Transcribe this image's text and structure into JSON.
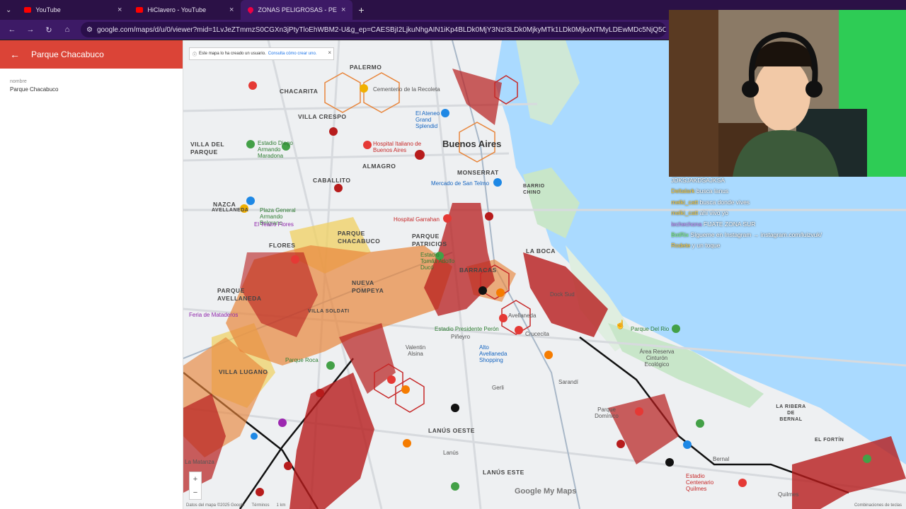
{
  "browser": {
    "tabs": [
      {
        "title": "YouTube",
        "active": false,
        "icon": "youtube-icon"
      },
      {
        "title": "HiClavero - YouTube",
        "active": false,
        "icon": "youtube-icon"
      },
      {
        "title": "ZONAS PELIGROSAS - PEYANE",
        "active": true,
        "icon": "google-maps-icon"
      }
    ],
    "url": "google.com/maps/d/u/0/viewer?mid=1LvJeZTmmzS0CGXn3jPtyTloEhWBM2-U&g_ep=CAESBjI2LjkuNhgAIN1iKp4BLDk0MjY3NzI3LDk0MjkyMTk1LDk0MjkxNTMyLDEwMDc5NjQ5OCwxMDA3OTY"
  },
  "panel": {
    "title": "Parque Chacabuco",
    "field_label": "nombre",
    "field_value": "Parque Chacabuco",
    "header_color": "#db4437"
  },
  "map": {
    "notice_text": "Este mapa lo ha creado un usuario.",
    "notice_link": "Consulta cómo crear uno.",
    "labels": {
      "palermo": "PALERMO",
      "recoleta": "Cementerio de la Recoleta",
      "chacarita": "CHACARITA",
      "villa_crespo": "VILLA CRESPO",
      "ateneo": "El Ateneo Grand Splendid",
      "buenos_aires": "Buenos Aires",
      "villa_del_parque": "VILLA DEL PARQUE",
      "maradona": "Estadio Diego Armando Maradona",
      "hospital_italiano": "Hospital Italiano de Buenos Aires",
      "almagro": "ALMAGRO",
      "monserrat": "MONSERRAT",
      "caballito": "CABALLITO",
      "san_telmo": "Mercado de San Telmo",
      "barrio_chino": "BARRIO CHINO",
      "nazca": "NAZCA",
      "avellaneda_av": "AVELLANEDA",
      "plaza_general": "Plaza General Armando Belgrano",
      "teatro_flores": "El Teatro Flores",
      "parque_chacabuco": "PARQUE CHACABUCO",
      "hospital_garrahan": "Hospital Garrahan",
      "flores": "FLORES",
      "parque_patricios": "PARQUE PATRICIOS",
      "estadio_tomas": "Estadio Tomás Adolfo Ducó",
      "barracas": "BARRACAS",
      "la_boca": "LA BOCA",
      "nueva_pompeya": "NUEVA POMPEYA",
      "parque_avellaneda": "PARQUE AVELLANEDA",
      "dock_sud": "Dock Sud",
      "feria_mataderos": "Feria de Mataderos",
      "villa_soldati": "VILLA SOLDATI",
      "avellaneda": "Avellaneda",
      "estadio_peron": "Estadio Presidente Perón",
      "pineyro": "Piñeyro",
      "crucecita": "Crucecita",
      "parque_del_rio": "Parque Del Rio",
      "area_reserva": "Área Reserva Cinturón Ecológico",
      "valentin_alsina": "Valentin Alsina",
      "alto_avellaneda": "Alto Avellaneda Shopping",
      "villa_lugano": "VILLA LUGANO",
      "parque_roca": "Parque Roca",
      "gerli": "Gerli",
      "sarandi": "Sarandí",
      "lanus_oeste": "LANÚS OESTE",
      "lanus": "Lanús",
      "lanus_este": "LANÚS ESTE",
      "dominico": "Parque Domínico",
      "la_ribera": "LA RIBERA DE BERNAL",
      "bernal": "Bernal",
      "el_fortin": "EL FORTÍN",
      "quilmes": "Quilmes",
      "estadio_quilmes": "Estadio Centenario Quilmes",
      "la_matanza": "La Matanza"
    },
    "zoom_in": "+",
    "zoom_out": "−",
    "footer_data": "Datos del mapa ©2025 Google",
    "footer_terms": "Términos",
    "footer_scale": "1 km",
    "footer_right": "Combinaciones de teclas",
    "watermark": "Google My Maps",
    "colors": {
      "danger_red": "#b71c1c",
      "danger_orange": "#e8863c",
      "danger_yellow": "#f0d060",
      "water": "#aadaff",
      "park": "#c8e6c9"
    }
  },
  "chat": {
    "messages": [
      {
        "user": "",
        "text": "JDKSJAKDSAJKSA"
      },
      {
        "user": "Deltalark",
        "text": "busca lanus"
      },
      {
        "user": "melki_catt",
        "text": "busca donde vives"
      },
      {
        "user": "melki_catt",
        "text": "ahi vivo yo"
      },
      {
        "user": "lechechona",
        "text": "FIJATE ZONA SUR"
      },
      {
        "user": "BotRix",
        "text": "Sígueme en Instagram → instagram.com/luizvuk/"
      },
      {
        "user": "Rodete",
        "text": "y un toque"
      }
    ]
  }
}
